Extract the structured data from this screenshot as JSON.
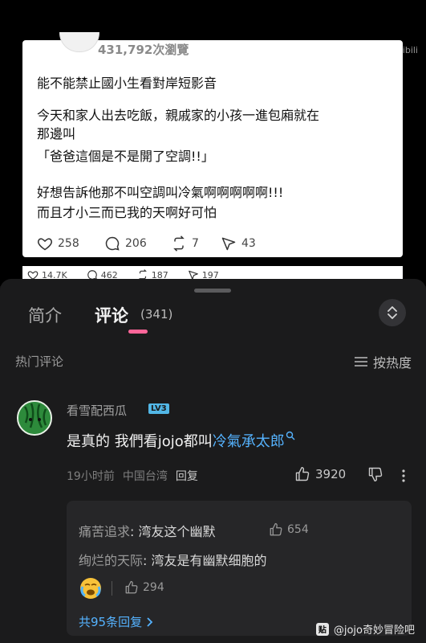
{
  "video": {
    "watermark": "bilibili",
    "post": {
      "views": "431,792次瀏覽",
      "title": "能不能禁止國小生看對岸短影音",
      "lines": [
        "今天和家人出去吃飯，親戚家的小孩一進包廂就在",
        "那邊叫",
        "「爸爸這個是不是開了空調!!」",
        "好想告訴他那不叫空調叫冷氣啊啊啊啊啊!!!",
        "而且才小三而已我的天啊好可怕"
      ],
      "stats": {
        "likes": "258",
        "comments": "206",
        "reposts": "7",
        "shares": "43"
      }
    },
    "lower_stats": {
      "likes": "14.7K",
      "comments": "462",
      "reposts": "187",
      "shares": "197"
    }
  },
  "panel": {
    "tabs": {
      "intro": "简介",
      "comments": "评论",
      "comment_count": "(341)"
    },
    "hot_label": "热门评论",
    "sort_label": "按热度",
    "comment": {
      "user": "看雪配西瓜",
      "level": "LV3",
      "text": "是真的 我們看jojo都叫",
      "link": "冷氣承太郎",
      "time": "19小时前",
      "location": "中国台湾",
      "reply": "回复",
      "likes": "3920"
    },
    "replies": [
      {
        "name": "痛苦追求",
        "text": "湾友这个幽默",
        "likes": "654"
      },
      {
        "name": "绚烂的天际",
        "text": "湾友是有幽默细胞的",
        "likes": "294"
      }
    ],
    "more_replies": "共95条回复"
  },
  "footer_watermark": "@jojo奇妙冒险吧",
  "colors": {
    "accent": "#ff6699",
    "link": "#55b3ff"
  }
}
